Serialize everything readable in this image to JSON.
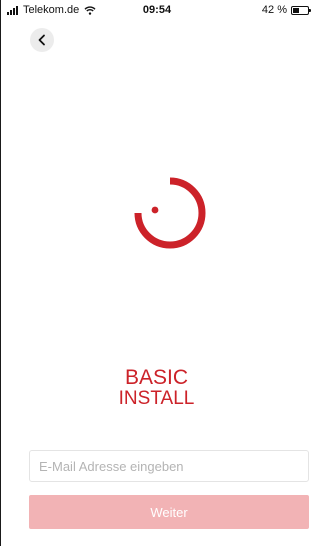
{
  "status_bar": {
    "carrier": "Telekom.de",
    "time": "09:54",
    "battery_text": "42 %",
    "battery_level": 0.42
  },
  "nav": {
    "back_icon": "chevron-left-icon"
  },
  "brand": {
    "line1": "BASIC",
    "line2": "INSTALL",
    "logo_icon": "power-ring-logo",
    "accent_color": "#cc2229"
  },
  "form": {
    "email_placeholder": "E-Mail Adresse eingeben",
    "email_value": "",
    "submit_label": "Weiter",
    "submit_color": "#f2b3b5"
  }
}
